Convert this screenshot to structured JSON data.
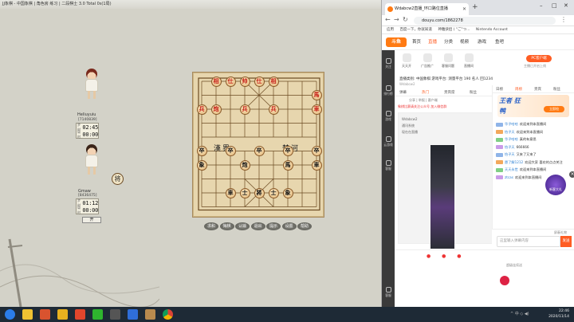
{
  "chess_app": {
    "title": "JJ象棋 - 中国象棋  | 角色房  练习 | 二段棋士  3.0  Total 0s(1局)",
    "top_player": {
      "name": "Heliuyuiu",
      "id": "[7140839]",
      "time_step_label": "步时",
      "time_step": "02:45",
      "time_game_label": "局时",
      "time_game": "00:00"
    },
    "bottom_player": {
      "name": "Gmaw",
      "id": "[8436475]",
      "time_step_label": "步时",
      "time_step": "01:12",
      "time_game_label": "局时",
      "time_game": "00:00"
    },
    "general_marker": "将",
    "small_button": "开",
    "river_left": "漢界",
    "river_right": "楚河",
    "controls": [
      "求和",
      "悔棋",
      "认输",
      "退出",
      "提示",
      "设置",
      "帮助"
    ],
    "pieces": [
      {
        "side": "red",
        "text": "相",
        "col": 1,
        "row": 0
      },
      {
        "side": "red",
        "text": "仕",
        "col": 2,
        "row": 0
      },
      {
        "side": "red",
        "text": "帅",
        "col": 3,
        "row": 0
      },
      {
        "side": "red",
        "text": "仕",
        "col": 4,
        "row": 0
      },
      {
        "side": "red",
        "text": "相",
        "col": 5,
        "row": 0
      },
      {
        "side": "red",
        "text": "馬",
        "col": 8,
        "row": 1
      },
      {
        "side": "red",
        "text": "兵",
        "col": 0,
        "row": 2
      },
      {
        "side": "red",
        "text": "炮",
        "col": 1,
        "row": 2
      },
      {
        "side": "red",
        "text": "兵",
        "col": 3,
        "row": 2
      },
      {
        "side": "red",
        "text": "兵",
        "col": 5,
        "row": 2
      },
      {
        "side": "red",
        "text": "車",
        "col": 8,
        "row": 2
      },
      {
        "side": "black",
        "text": "卒",
        "col": 0,
        "row": 5
      },
      {
        "side": "black",
        "text": "卒",
        "col": 2,
        "row": 5
      },
      {
        "side": "black",
        "text": "卒",
        "col": 4,
        "row": 5
      },
      {
        "side": "black",
        "text": "卒",
        "col": 6,
        "row": 5
      },
      {
        "side": "black",
        "text": "卒",
        "col": 8,
        "row": 5
      },
      {
        "side": "black",
        "text": "象",
        "col": 0,
        "row": 6
      },
      {
        "side": "black",
        "text": "炮",
        "col": 3,
        "row": 6
      },
      {
        "side": "black",
        "text": "馬",
        "col": 6,
        "row": 6
      },
      {
        "side": "black",
        "text": "車",
        "col": 8,
        "row": 6
      },
      {
        "side": "black",
        "text": "士",
        "col": 3,
        "row": 8
      },
      {
        "side": "black",
        "text": "將",
        "col": 4,
        "row": 8
      },
      {
        "side": "black",
        "text": "士",
        "col": 5,
        "row": 8
      },
      {
        "side": "black",
        "text": "象",
        "col": 6,
        "row": 8
      },
      {
        "side": "black",
        "text": "車",
        "col": 2,
        "row": 8
      }
    ]
  },
  "browser": {
    "tab_title": "Wdabcw2直播_环口路位直播",
    "url": "douyu.com/1862278",
    "bookmarks": [
      "应用",
      "百度一下，你就知道",
      "神雕侠侣 ( \"ご\"つ...",
      "Nintendo Account"
    ],
    "site_logo": "斗鱼",
    "nav": [
      "首页",
      "直播",
      "分类",
      "视频",
      "游戏",
      "鱼吧"
    ],
    "rail": [
      "关注",
      "排行榜",
      "游戏",
      "云游戏",
      "客服",
      "客服"
    ],
    "dl_icons": [
      "天天开",
      "广告推广",
      "客服问题",
      "直播间"
    ],
    "pc_button": "PC客户端",
    "pc_sub": "主播已开启上线",
    "room_title": "直播类别: 中国象棋 游戏平台: 测量平台 190 名人 回1234",
    "room_sub": "Wdabcw2",
    "room_tabs": [
      "弹幕",
      "热门",
      "贵宾席",
      "粉丝"
    ],
    "share_row": "分享  |  举报  |  客户端",
    "promo_text": "象棋比赛请关注公众号 加入微信群",
    "video_info": [
      "Wdabcw2",
      "通讯系统",
      "现在在直播"
    ],
    "chat_tabs": [
      "日榜",
      "周榜",
      "贵宾",
      "粉丝"
    ],
    "promo_logo": "王者 狂鸭",
    "promo_button": "立即抢",
    "chat_messages": [
      {
        "user": "华子哈哈",
        "msg": "欢迎来到本直播间"
      },
      {
        "user": "恰子天",
        "msg": "欢迎来到本直播间"
      },
      {
        "user": "华子哈哈",
        "msg": "真的有意思"
      },
      {
        "user": "恰子天",
        "msg": "666666"
      },
      {
        "user": "恰子天",
        "msg": "又来了又来了"
      },
      {
        "user": "愿了解1212",
        "msg": "欢迎大家 喜欢的点点关注"
      },
      {
        "user": "天天永世",
        "msg": "欢迎来到本直播间"
      },
      {
        "user": "ztcas",
        "msg": "欢迎来到本直播间"
      }
    ],
    "ad_label": "新客大礼",
    "block_label": "屏蔽礼物",
    "chat_placeholder": "这里输入弹幕内容",
    "send_label": "发送",
    "gift_label": "超级连续送"
  },
  "taskbar": {
    "time": "22:46",
    "date": "2020/11/14",
    "tray": "^ 中 ◇ ◀)"
  }
}
